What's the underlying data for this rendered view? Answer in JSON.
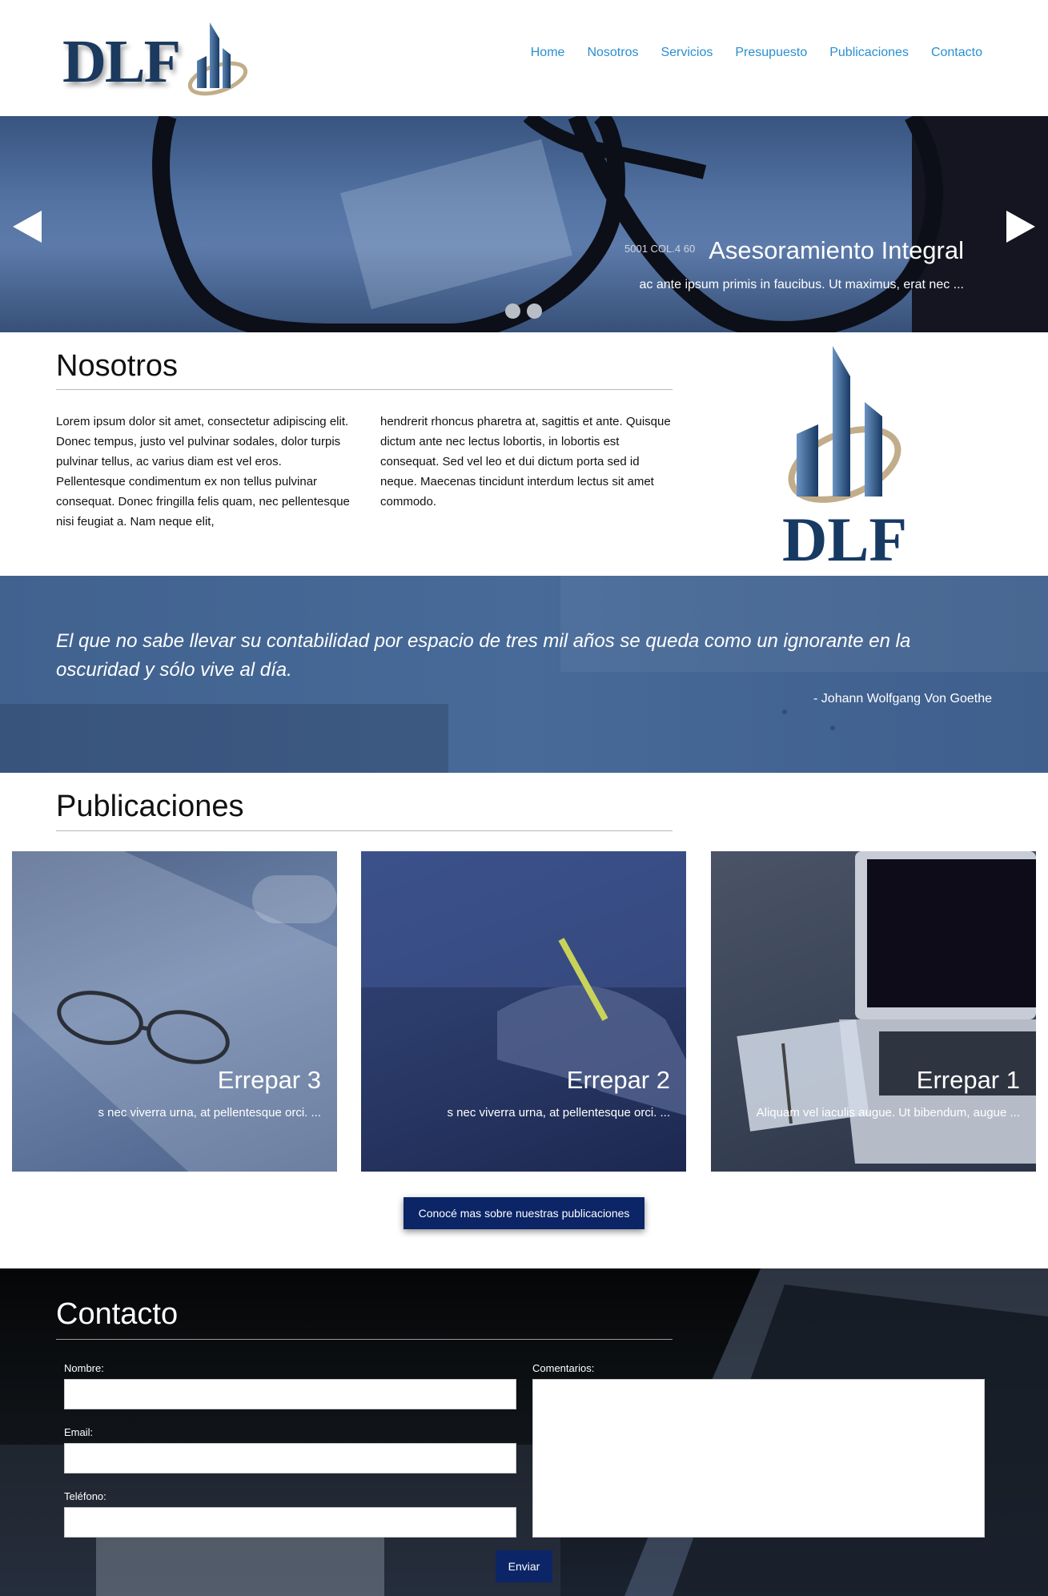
{
  "header": {
    "logo_text": "DLF",
    "nav": [
      "Home",
      "Nosotros",
      "Servicios",
      "Presupuesto",
      "Publicaciones",
      "Contacto"
    ]
  },
  "hero": {
    "title": "Asesoramiento Integral",
    "subtitle": "ac ante ipsum primis in faucibus. Ut maximus, erat nec ...",
    "slide_count": 2,
    "active_slide": 1
  },
  "nosotros": {
    "title": "Nosotros",
    "col1": "Lorem ipsum dolor sit amet, consectetur adipiscing elit. Donec tempus, justo vel pulvinar sodales, dolor turpis pulvinar tellus, ac varius diam est vel eros. Pellentesque condimentum ex non tellus pulvinar consequat. Donec fringilla felis quam, nec pellentesque nisi feugiat a. Nam neque elit,",
    "col2": "hendrerit rhoncus pharetra at, sagittis et ante. Quisque dictum ante nec lectus lobortis, in lobortis est consequat. Sed vel leo et dui dictum porta sed id neque. Maecenas tincidunt interdum lectus sit amet commodo.",
    "logo_text": "DLF"
  },
  "quote": {
    "text": "El que no sabe llevar su contabilidad por espacio de tres mil años se queda como un ignorante en la oscuridad y sólo vive al día.",
    "author": "- Johann Wolfgang Von Goethe"
  },
  "publicaciones": {
    "title": "Publicaciones",
    "cards": [
      {
        "title": "Errepar 3",
        "subtitle": "s nec viverra urna, at pellentesque orci. ..."
      },
      {
        "title": "Errepar 2",
        "subtitle": "s nec viverra urna, at pellentesque orci. ..."
      },
      {
        "title": "Errepar 1",
        "subtitle": "Aliquam vel iaculis augue. Ut bibendum, augue ..."
      }
    ],
    "button_label": "Conocé mas sobre nuestras publicaciones"
  },
  "contacto": {
    "title": "Contacto",
    "labels": {
      "nombre": "Nombre:",
      "email": "Email:",
      "telefono": "Teléfono:",
      "comentarios": "Comentarios:"
    },
    "values": {
      "nombre": "",
      "email": "",
      "telefono": "",
      "comentarios": ""
    },
    "send_label": "Enviar"
  },
  "colors": {
    "nav_link": "#2a8fd0",
    "brand_navy": "#1c3a5e",
    "button_navy": "#0b2566",
    "brand_gold": "#c2ad8a"
  }
}
